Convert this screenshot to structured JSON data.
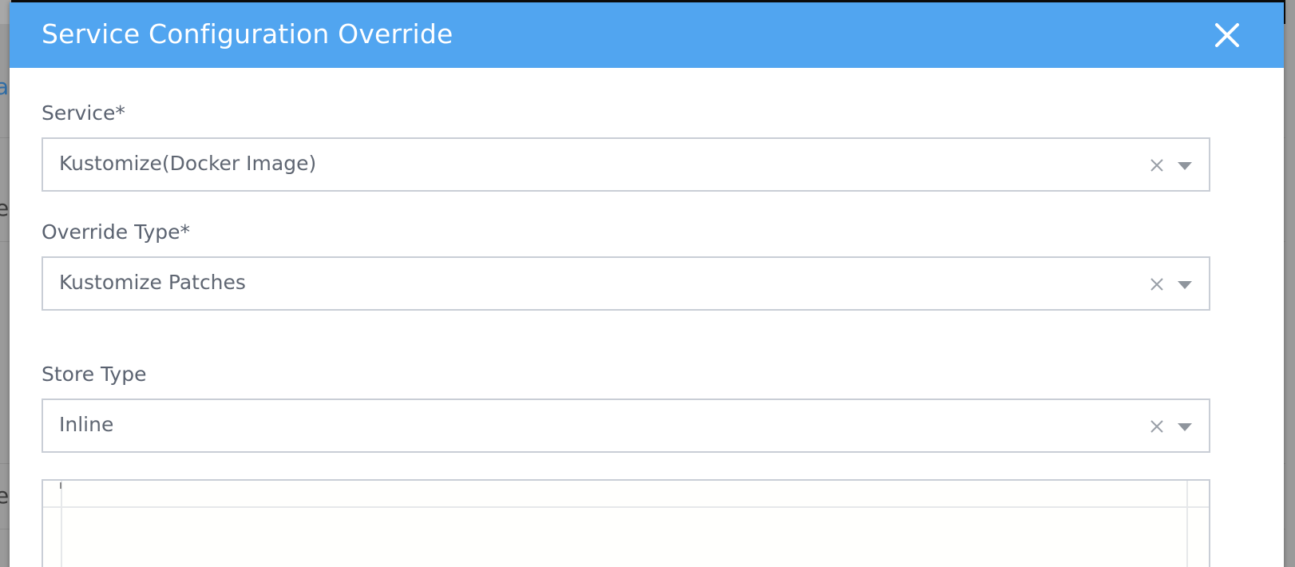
{
  "modal": {
    "title": "Service Configuration Override",
    "close_icon": "close-icon"
  },
  "form": {
    "service": {
      "label": "Service*",
      "value": "Kustomize(Docker Image)"
    },
    "override_type": {
      "label": "Override Type*",
      "value": "Kustomize Patches"
    },
    "store_type": {
      "label": "Store Type",
      "value": "Inline"
    }
  },
  "colors": {
    "header": "#51a5f0",
    "label": "#5a6270",
    "border": "#c9ced6"
  }
}
